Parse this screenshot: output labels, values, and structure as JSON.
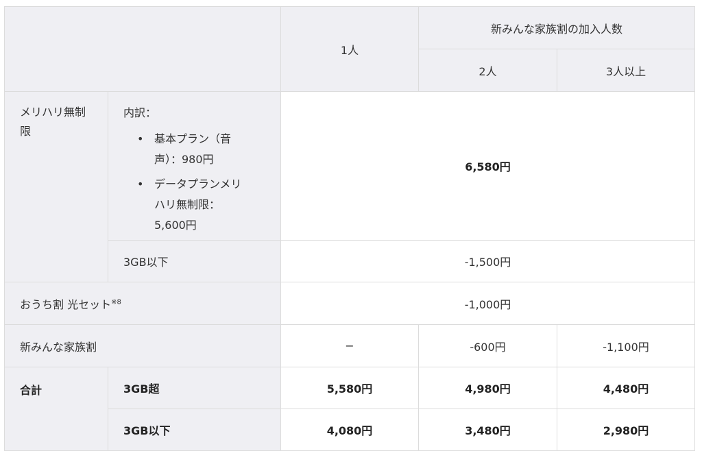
{
  "header": {
    "corner": "",
    "one_person": "1人",
    "group_title": "新みんな家族割の加入人数",
    "two_people": "2人",
    "three_plus": "3人以上"
  },
  "rows": {
    "merihari": {
      "label": "メリハリ無制限",
      "breakdown_title": "内訳：",
      "items": [
        "基本プラン（音声）：980円",
        "データプランメリハリ無制限：5,600円"
      ],
      "value": "6,580円",
      "under3gb_label": "3GB以下",
      "under3gb_value": "-1,500円"
    },
    "ouchi": {
      "label": "おうち割 光セット",
      "note": "※8",
      "value": "-1,000円"
    },
    "family": {
      "label": "新みんな家族割",
      "one": "−",
      "two": "-600円",
      "three": "-1,100円"
    },
    "total": {
      "label": "合計",
      "over3gb_label": "3GB超",
      "over3gb": [
        "5,580円",
        "4,980円",
        "4,480円"
      ],
      "under3gb_label": "3GB以下",
      "under3gb": [
        "4,080円",
        "3,480円",
        "2,980円"
      ]
    }
  }
}
